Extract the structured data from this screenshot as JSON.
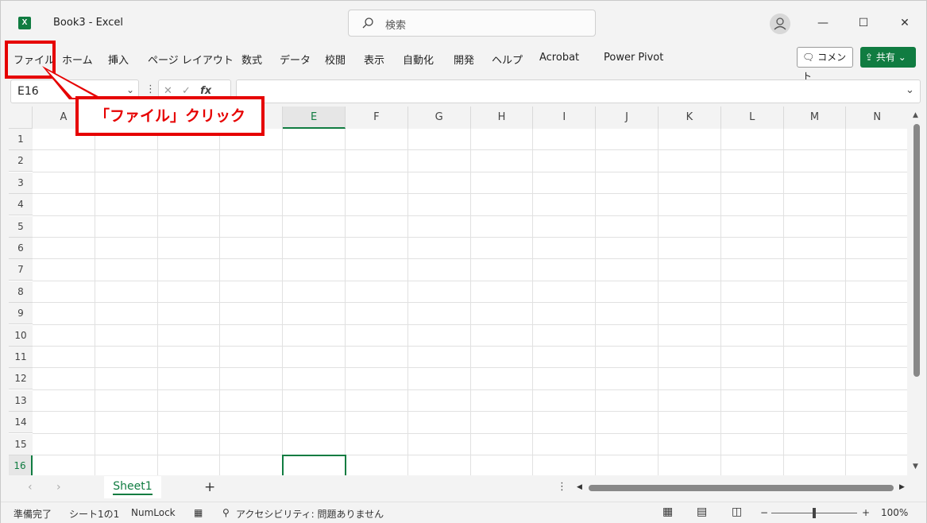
{
  "app": {
    "title": "Book3  -  Excel",
    "logo_letter": "X"
  },
  "search": {
    "placeholder": "検索"
  },
  "window_controls": {
    "minimize": "—",
    "maximize": "☐",
    "close": "✕"
  },
  "ribbon": {
    "tabs": [
      "ファイル",
      "ホーム",
      "挿入",
      "ページ レイアウト",
      "数式",
      "データ",
      "校閲",
      "表示",
      "自動化",
      "開発",
      "ヘルプ",
      "Acrobat",
      "Power Pivot"
    ],
    "comment_label": "コメント",
    "share_label": "共有"
  },
  "formula_bar": {
    "name_box": "E16",
    "fx_label": "fx",
    "formula": ""
  },
  "callout": {
    "text": "「ファイル」クリック",
    "color": "#e60000"
  },
  "grid": {
    "columns": [
      "A",
      "B",
      "C",
      "D",
      "E",
      "F",
      "G",
      "H",
      "I",
      "J",
      "K",
      "L",
      "M",
      "N"
    ],
    "rows": [
      "1",
      "2",
      "3",
      "4",
      "5",
      "6",
      "7",
      "8",
      "9",
      "10",
      "11",
      "12",
      "13",
      "14",
      "15",
      "16"
    ],
    "selected_cell": "E16",
    "accent": "#107c41"
  },
  "sheets": {
    "tabs": [
      "Sheet1"
    ],
    "active": "Sheet1",
    "add_label": "+"
  },
  "status": {
    "ready": "準備完了",
    "sheet_info": "シート1の1",
    "numlock": "NumLock",
    "accessibility": "アクセシビリティ: 問題ありません",
    "zoom_minus": "−",
    "zoom_plus": "+",
    "zoom": "100%"
  }
}
